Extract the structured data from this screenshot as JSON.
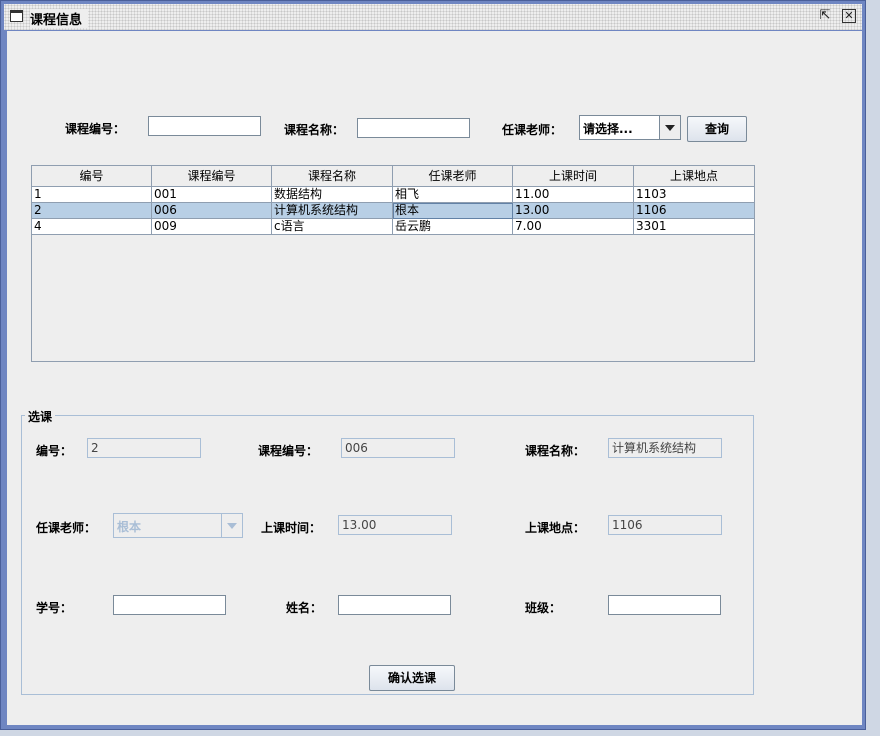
{
  "window": {
    "title": "课程信息"
  },
  "search": {
    "course_no_label": "课程编号：",
    "course_no_value": "",
    "course_name_label": "课程名称：",
    "course_name_value": "",
    "teacher_label": "任课老师：",
    "teacher_selected": "请选择...",
    "query_label": "查询"
  },
  "table": {
    "headers": [
      "编号",
      "课程编号",
      "课程名称",
      "任课老师",
      "上课时间",
      "上课地点"
    ],
    "rows": [
      [
        "1",
        "001",
        "数据结构",
        "相飞",
        "11.00",
        "1103"
      ],
      [
        "2",
        "006",
        "计算机系统结构",
        "根本",
        "13.00",
        "1106"
      ],
      [
        "4",
        "009",
        "c语言",
        "岳云鹏",
        "7.00",
        "3301"
      ]
    ],
    "selected_row": 1
  },
  "select": {
    "group_title": "选课",
    "id_label": "编号：",
    "id_value": "2",
    "course_no_label": "课程编号：",
    "course_no_value": "006",
    "course_name_label": "课程名称：",
    "course_name_value": "计算机系统结构",
    "teacher_label": "任课老师：",
    "teacher_value": "根本",
    "time_label": "上课时间：",
    "time_value": "13.00",
    "place_label": "上课地点：",
    "place_value": "1106",
    "student_no_label": "学号：",
    "student_no_value": "",
    "name_label": "姓名：",
    "name_value": "",
    "class_label": "班级：",
    "class_value": "",
    "confirm_label": "确认选课"
  },
  "icons": {
    "window": "window-icon",
    "restore": "restore-icon",
    "close": "close-icon",
    "dropdown": "chevron-down-icon"
  },
  "colors": {
    "frame": "#6f86c2",
    "selection": "#b8cfe5",
    "panel": "#eeeeee"
  }
}
